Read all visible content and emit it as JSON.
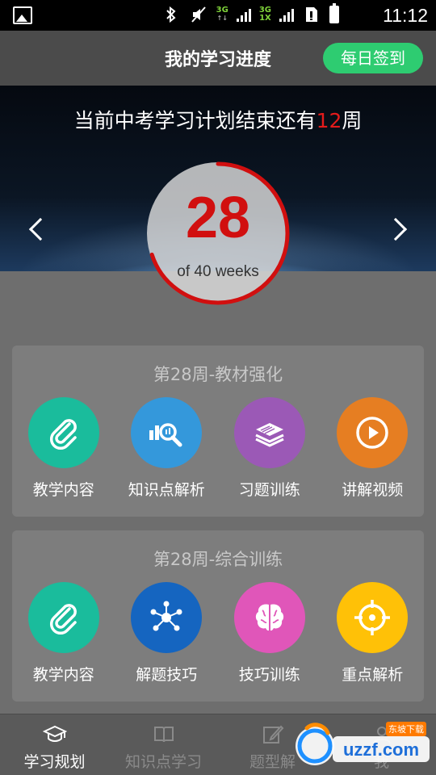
{
  "status_bar": {
    "time": "11:12",
    "network_top": "3G",
    "network_bottom": "1X",
    "icons": [
      "image-icon",
      "bluetooth-icon",
      "mute-icon",
      "signal-icon",
      "sim-icon",
      "battery-icon"
    ]
  },
  "header": {
    "title": "我的学习进度",
    "checkin_label": "每日签到"
  },
  "hero": {
    "text_prefix": "当前中考学习计划结束还有",
    "weeks_left": "12",
    "text_suffix": "周",
    "progress": {
      "current": "28",
      "of_label": "of 40 weeks",
      "total": 40,
      "fraction": 0.7
    }
  },
  "card1": {
    "title": "第28周-教材强化",
    "items": [
      {
        "label": "教学内容",
        "icon": "paperclip-icon",
        "color": "#1abc9c"
      },
      {
        "label": "知识点解析",
        "icon": "chart-magnifier-icon",
        "color": "#3498db"
      },
      {
        "label": "习题训练",
        "icon": "stack-icon",
        "color": "#9b59b6"
      },
      {
        "label": "讲解视频",
        "icon": "play-icon",
        "color": "#e67e22"
      }
    ]
  },
  "card2": {
    "title": "第28周-综合训练",
    "items": [
      {
        "label": "教学内容",
        "icon": "paperclip-icon",
        "color": "#1abc9c"
      },
      {
        "label": "解题技巧",
        "icon": "network-icon",
        "color": "#1565c0"
      },
      {
        "label": "技巧训练",
        "icon": "brain-icon",
        "color": "#e056b9"
      },
      {
        "label": "重点解析",
        "icon": "target-icon",
        "color": "#ffc107"
      }
    ]
  },
  "bottom_nav": [
    {
      "label": "学习规划",
      "icon": "graduation-cap-icon",
      "active": true
    },
    {
      "label": "知识点学习",
      "icon": "book-icon",
      "active": false
    },
    {
      "label": "题型解",
      "icon": "edit-icon",
      "active": false
    },
    {
      "label": "我",
      "icon": "user-icon",
      "active": false
    }
  ],
  "watermark": {
    "text": "uzzf.com",
    "sub": "东坡下载"
  }
}
